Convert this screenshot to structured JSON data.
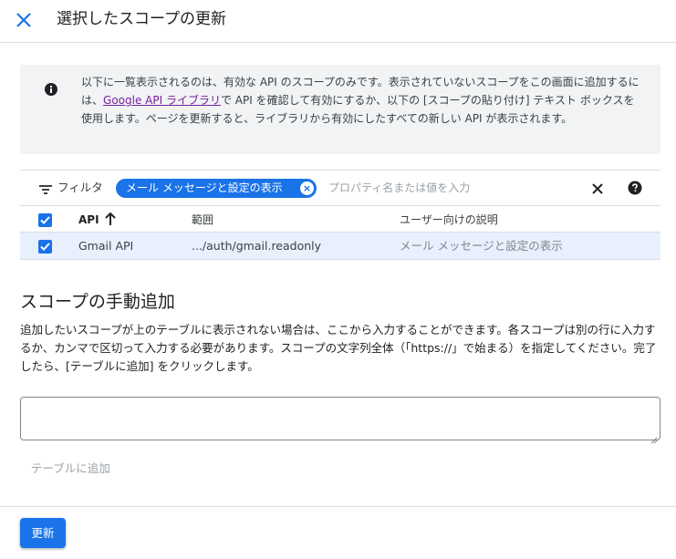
{
  "dialog": {
    "title": "選択したスコープの更新"
  },
  "info": {
    "text_before_link": "以下に一覧表示されるのは、有効な API のスコープのみです。表示されていないスコープをこの画面に追加するには、",
    "link_label": "Google API ライブラリ",
    "text_after_link": "で API を確認して有効にするか、以下の [スコープの貼り付け] テキスト ボックスを使用します。ページを更新すると、ライブラリから有効にしたすべての新しい API が表示されます。"
  },
  "filter": {
    "label": "フィルタ",
    "chip_label": "メール メッセージと設定の表示",
    "placeholder": "プロパティ名または値を入力"
  },
  "table": {
    "headers": {
      "api": "API",
      "scope": "範囲",
      "description": "ユーザー向けの説明"
    },
    "header_checked": true,
    "rows": [
      {
        "api": "Gmail API",
        "scope": ".../auth/gmail.readonly",
        "description": "メール メッセージと設定の表示",
        "checked": true
      }
    ]
  },
  "manual": {
    "title": "スコープの手動追加",
    "description": "追加したいスコープが上のテーブルに表示されない場合は、ここから入力することができます。各スコープは別の行に入力するか、カンマで区切って入力する必要があります。スコープの文字列全体（「https://」で始まる）を指定してください。完了したら、[テーブルに追加] をクリックします。",
    "textarea_value": "",
    "add_button": "テーブルに追加"
  },
  "footer": {
    "update_button": "更新"
  },
  "colors": {
    "accent": "#1a73e8",
    "selected_row": "#e8f0fe",
    "info_bg": "#f1f3f4",
    "link": "#7b1fa2",
    "divider": "#dadce0"
  },
  "icons": [
    "close-icon",
    "info-icon",
    "filter-icon",
    "chip-remove-icon",
    "clear-filter-icon",
    "help-icon",
    "sort-arrow-up-icon",
    "checkbox-checked-icon",
    "resize-handle-icon"
  ]
}
